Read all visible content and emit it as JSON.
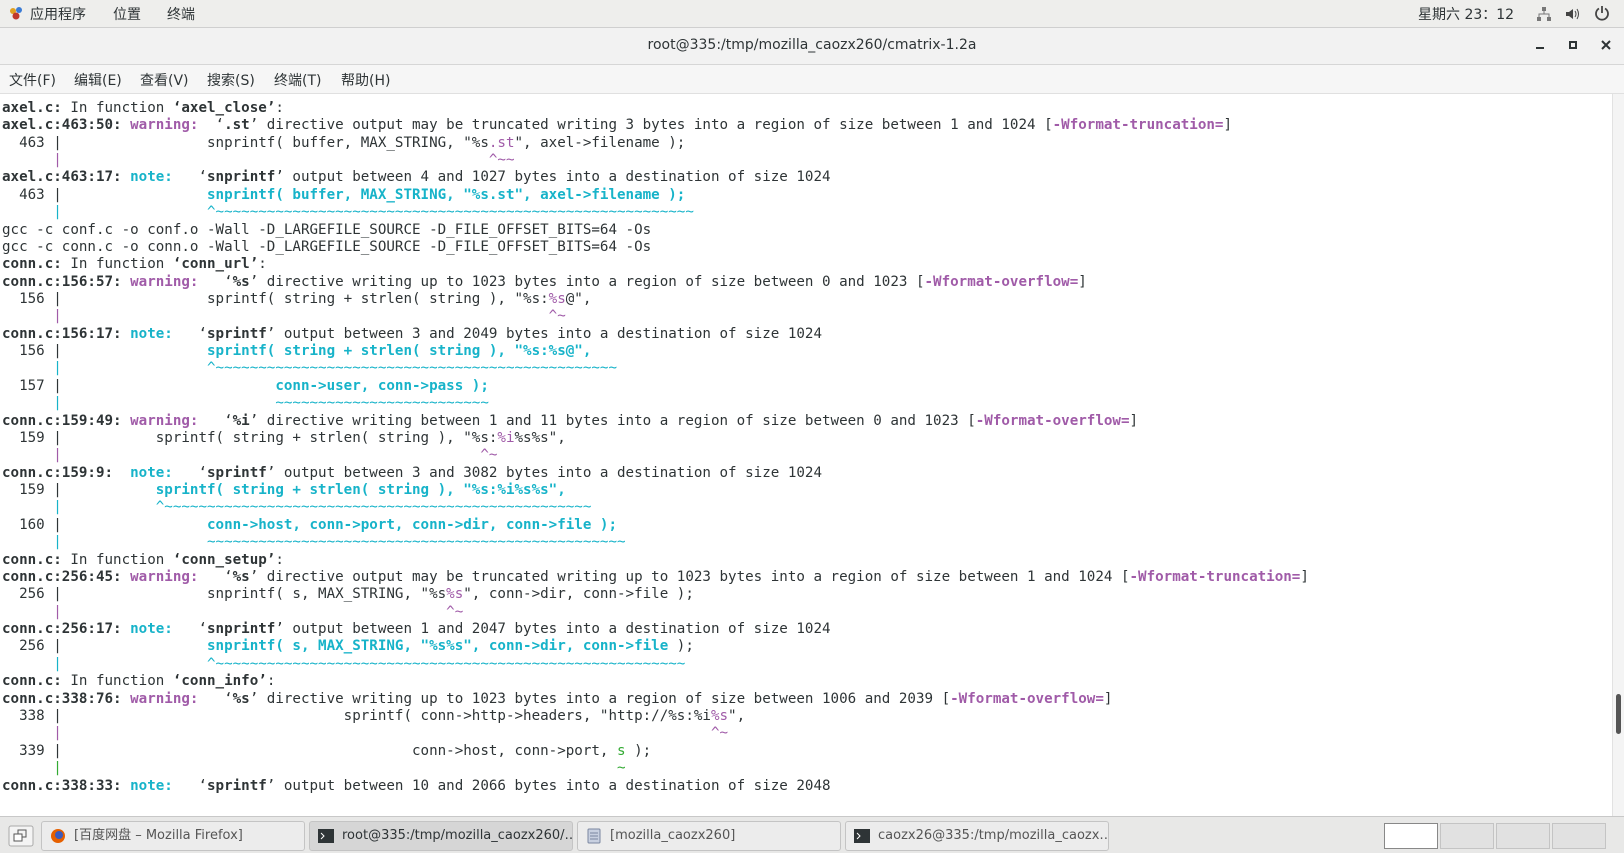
{
  "top_panel": {
    "menus": [
      "应用程序",
      "位置",
      "终端"
    ],
    "clock": "星期六 23：12",
    "icons": [
      "network-icon",
      "volume-icon",
      "power-icon"
    ]
  },
  "window": {
    "title": "root@335:/tmp/mozilla_caozx260/cmatrix-1.2a",
    "controls": [
      "minimize",
      "maximize",
      "close"
    ]
  },
  "menubar": [
    "文件(F)",
    "编辑(E)",
    "查看(V)",
    "搜索(S)",
    "终端(T)",
    "帮助(H)"
  ],
  "terminal": {
    "lines": [
      [
        {
          "t": "axel.c:",
          "s": "b"
        },
        {
          "t": " In function "
        },
        {
          "t": "‘axel_close’",
          "s": "b"
        },
        {
          "t": ":"
        }
      ],
      [
        {
          "t": "axel.c:463:50: ",
          "s": "b"
        },
        {
          "t": "warning: ",
          "s": "w"
        },
        {
          "t": " ‘"
        },
        {
          "t": ".st",
          "s": "b"
        },
        {
          "t": "’ directive output may be truncated writing 3 bytes into a region of size between 1 and 1024 ["
        },
        {
          "t": "-Wformat-truncation=",
          "s": "w"
        },
        {
          "t": "]"
        }
      ],
      [
        {
          "t": "  463 |                 snprintf( buffer, MAX_STRING, \"%s"
        },
        {
          "t": ".st",
          "s": "m"
        },
        {
          "t": "\", axel->filename );"
        }
      ],
      [
        {
          "t": "      |                                                  ^~~",
          "s": "caret"
        }
      ],
      [
        {
          "t": "axel.c:463:17: ",
          "s": "b"
        },
        {
          "t": "note: ",
          "s": "n"
        },
        {
          "t": "  ‘"
        },
        {
          "t": "snprintf",
          "s": "b"
        },
        {
          "t": "’ output between 4 and 1027 bytes into a destination of size 1024"
        }
      ],
      [
        {
          "t": "  463 |                 "
        },
        {
          "t": "snprintf( buffer, MAX_STRING, \"%s.st\", axel->filename );",
          "s": "c"
        }
      ],
      [
        {
          "t": "      |                 ^~~~~~~~~~~~~~~~~~~~~~~~~~~~~~~~~~~~~~~~~~~~~~~~~~~~~~~~~",
          "s": "caretc"
        }
      ],
      [
        {
          "t": "gcc -c conf.c -o conf.o -Wall -D_LARGEFILE_SOURCE -D_FILE_OFFSET_BITS=64 -Os"
        }
      ],
      [
        {
          "t": "gcc -c conn.c -o conn.o -Wall -D_LARGEFILE_SOURCE -D_FILE_OFFSET_BITS=64 -Os"
        }
      ],
      [
        {
          "t": "conn.c:",
          "s": "b"
        },
        {
          "t": " In function "
        },
        {
          "t": "‘conn_url’",
          "s": "b"
        },
        {
          "t": ":"
        }
      ],
      [
        {
          "t": "conn.c:156:57: ",
          "s": "b"
        },
        {
          "t": "warning: ",
          "s": "w"
        },
        {
          "t": "  ‘"
        },
        {
          "t": "%s",
          "s": "b"
        },
        {
          "t": "’ directive writing up to 1023 bytes into a region of size between 0 and 1023 ["
        },
        {
          "t": "-Wformat-overflow=",
          "s": "w"
        },
        {
          "t": "]"
        }
      ],
      [
        {
          "t": "  156 |                 sprintf( string + strlen( string ), \"%s:"
        },
        {
          "t": "%s",
          "s": "m"
        },
        {
          "t": "@\","
        }
      ],
      [
        {
          "t": "      |                                                         ^~",
          "s": "caret"
        }
      ],
      [
        {
          "t": "conn.c:156:17: ",
          "s": "b"
        },
        {
          "t": "note: ",
          "s": "n"
        },
        {
          "t": "  ‘"
        },
        {
          "t": "sprintf",
          "s": "b"
        },
        {
          "t": "’ output between 3 and 2049 bytes into a destination of size 1024"
        }
      ],
      [
        {
          "t": "  156 |                 "
        },
        {
          "t": "sprintf( string + strlen( string ), \"%s:%s@\",",
          "s": "c"
        }
      ],
      [
        {
          "t": "      |                 ^~~~~~~~~~~~~~~~~~~~~~~~~~~~~~~~~~~~~~~~~~~~~~~~",
          "s": "caretc"
        }
      ],
      [
        {
          "t": "  157 |                         "
        },
        {
          "t": "conn->user, conn->pass );",
          "s": "c"
        }
      ],
      [
        {
          "t": "      |                         ~~~~~~~~~~~~~~~~~~~~~~~~~",
          "s": "caretc"
        }
      ],
      [
        {
          "t": "conn.c:159:49: ",
          "s": "b"
        },
        {
          "t": "warning: ",
          "s": "w"
        },
        {
          "t": "  ‘"
        },
        {
          "t": "%i",
          "s": "b"
        },
        {
          "t": "’ directive writing between 1 and 11 bytes into a region of size between 0 and 1023 ["
        },
        {
          "t": "-Wformat-overflow=",
          "s": "w"
        },
        {
          "t": "]"
        }
      ],
      [
        {
          "t": "  159 |           sprintf( string + strlen( string ), \"%s:"
        },
        {
          "t": "%i",
          "s": "m"
        },
        {
          "t": "%s%s\","
        }
      ],
      [
        {
          "t": "      |                                                 ^~",
          "s": "caret"
        }
      ],
      [
        {
          "t": "conn.c:159:9: ",
          "s": "b"
        },
        {
          "t": " note: ",
          "s": "n"
        },
        {
          "t": "  ‘"
        },
        {
          "t": "sprintf",
          "s": "b"
        },
        {
          "t": "’ output between 3 and 3082 bytes into a destination of size 1024"
        }
      ],
      [
        {
          "t": "  159 |           "
        },
        {
          "t": "sprintf( string + strlen( string ), \"%s:%i%s%s\",",
          "s": "c"
        }
      ],
      [
        {
          "t": "      |           ^~~~~~~~~~~~~~~~~~~~~~~~~~~~~~~~~~~~~~~~~~~~~~~~~~~",
          "s": "caretc"
        }
      ],
      [
        {
          "t": "  160 |                 "
        },
        {
          "t": "conn->host, conn->port, conn->dir, conn->file );",
          "s": "c"
        }
      ],
      [
        {
          "t": "      |                 ~~~~~~~~~~~~~~~~~~~~~~~~~~~~~~~~~~~~~~~~~~~~~~~~~",
          "s": "caretc"
        }
      ],
      [
        {
          "t": "conn.c:",
          "s": "b"
        },
        {
          "t": " In function "
        },
        {
          "t": "‘conn_setup’",
          "s": "b"
        },
        {
          "t": ":"
        }
      ],
      [
        {
          "t": "conn.c:256:45: ",
          "s": "b"
        },
        {
          "t": "warning: ",
          "s": "w"
        },
        {
          "t": "  ‘"
        },
        {
          "t": "%s",
          "s": "b"
        },
        {
          "t": "’ directive output may be truncated writing up to 1023 bytes into a region of size between 1 and 1024 ["
        },
        {
          "t": "-Wformat-truncation=",
          "s": "w"
        },
        {
          "t": "]"
        }
      ],
      [
        {
          "t": "  256 |                 snprintf( s, MAX_STRING, \"%s"
        },
        {
          "t": "%s",
          "s": "m"
        },
        {
          "t": "\", conn->dir, conn->file );"
        }
      ],
      [
        {
          "t": "      |                                             ^~",
          "s": "caret"
        }
      ],
      [
        {
          "t": "conn.c:256:17: ",
          "s": "b"
        },
        {
          "t": "note: ",
          "s": "n"
        },
        {
          "t": "  ‘"
        },
        {
          "t": "snprintf",
          "s": "b"
        },
        {
          "t": "’ output between 1 and 2047 bytes into a destination of size 1024"
        }
      ],
      [
        {
          "t": "  256 |                 "
        },
        {
          "t": "snprintf( s, MAX_STRING, \"%s%s\", conn->dir, conn->file ",
          "s": "c"
        },
        {
          "t": ");"
        }
      ],
      [
        {
          "t": "      |                 ^~~~~~~~~~~~~~~~~~~~~~~~~~~~~~~~~~~~~~~~~~~~~~~~~~~~~~~~",
          "s": "caretc"
        }
      ],
      [
        {
          "t": "conn.c:",
          "s": "b"
        },
        {
          "t": " In function "
        },
        {
          "t": "‘conn_info’",
          "s": "b"
        },
        {
          "t": ":"
        }
      ],
      [
        {
          "t": "conn.c:338:76: ",
          "s": "b"
        },
        {
          "t": "warning: ",
          "s": "w"
        },
        {
          "t": "  ‘"
        },
        {
          "t": "%s",
          "s": "b"
        },
        {
          "t": "’ directive writing up to 1023 bytes into a region of size between 1006 and 2039 ["
        },
        {
          "t": "-Wformat-overflow=",
          "s": "w"
        },
        {
          "t": "]"
        }
      ],
      [
        {
          "t": "  338 |                                 sprintf( conn->http->headers, \"http://%s:%i"
        },
        {
          "t": "%s",
          "s": "m"
        },
        {
          "t": "\","
        }
      ],
      [
        {
          "t": "      |                                                                            ^~",
          "s": "caret"
        }
      ],
      [
        {
          "t": "  339 |                                         conn->host, conn->port, "
        },
        {
          "t": "s",
          "s": "g"
        },
        {
          "t": " );"
        }
      ],
      [
        {
          "t": "      |                                                                 ~",
          "s": "g"
        }
      ],
      [
        {
          "t": "conn.c:338:33: ",
          "s": "b"
        },
        {
          "t": "note: ",
          "s": "n"
        },
        {
          "t": "  ‘"
        },
        {
          "t": "sprintf",
          "s": "b"
        },
        {
          "t": "’ output between 10 and 2066 bytes into a destination of size 2048"
        }
      ]
    ],
    "line_tops": [
      5,
      22,
      40,
      57,
      74,
      92,
      109,
      127,
      144,
      161,
      179,
      196,
      213,
      231,
      248,
      265,
      283,
      300,
      318,
      335,
      352,
      370,
      387,
      404,
      422,
      439,
      457,
      474,
      491,
      509,
      526,
      543,
      561,
      578,
      596,
      613,
      630,
      648,
      665,
      683
    ]
  },
  "taskbar": {
    "tasks": [
      {
        "label": "[百度网盘 – Mozilla Firefox]",
        "icon": "firefox-icon",
        "active": false
      },
      {
        "label": "root@335:/tmp/mozilla_caozx260/…",
        "icon": "terminal-icon",
        "active": true
      },
      {
        "label": "[mozilla_caozx260]",
        "icon": "file-manager-icon",
        "active": false
      },
      {
        "label": "caozx26@335:/tmp/mozilla_caozx…",
        "icon": "terminal-icon",
        "active": false
      }
    ],
    "workspaces": 4,
    "active_workspace": 1
  }
}
